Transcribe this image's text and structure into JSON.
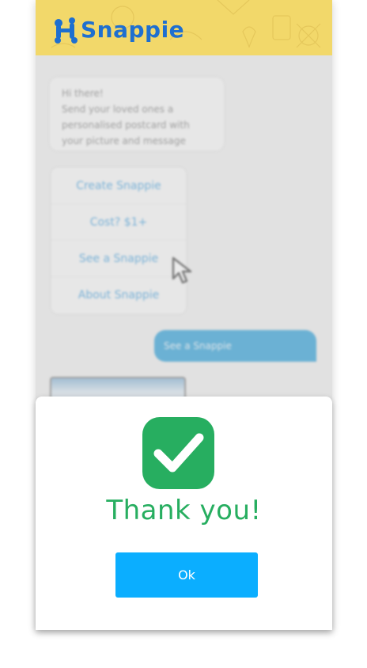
{
  "app": {
    "logo_text": "Snappie",
    "logo_icon": "snappie-logo-icon",
    "brand_color": "#1e6fd0",
    "header_color": "#f2d86a"
  },
  "chat": {
    "greeting": {
      "line1": "Hi there!",
      "line2": "Send your loved ones a",
      "line3": "personalised postcard with",
      "line4": "your picture and message"
    },
    "menu": [
      {
        "label": "Create Snappie"
      },
      {
        "label": "Cost? $1+"
      },
      {
        "label": "See a Snappie"
      },
      {
        "label": "About Snappie"
      }
    ],
    "user_message": "See a Snappie",
    "cursor_icon": "pointer-cursor-icon"
  },
  "modal": {
    "icon": "check-icon",
    "title": "Thank you!",
    "ok_label": "Ok",
    "title_color": "#27ae60",
    "button_color": "#0baeff"
  }
}
